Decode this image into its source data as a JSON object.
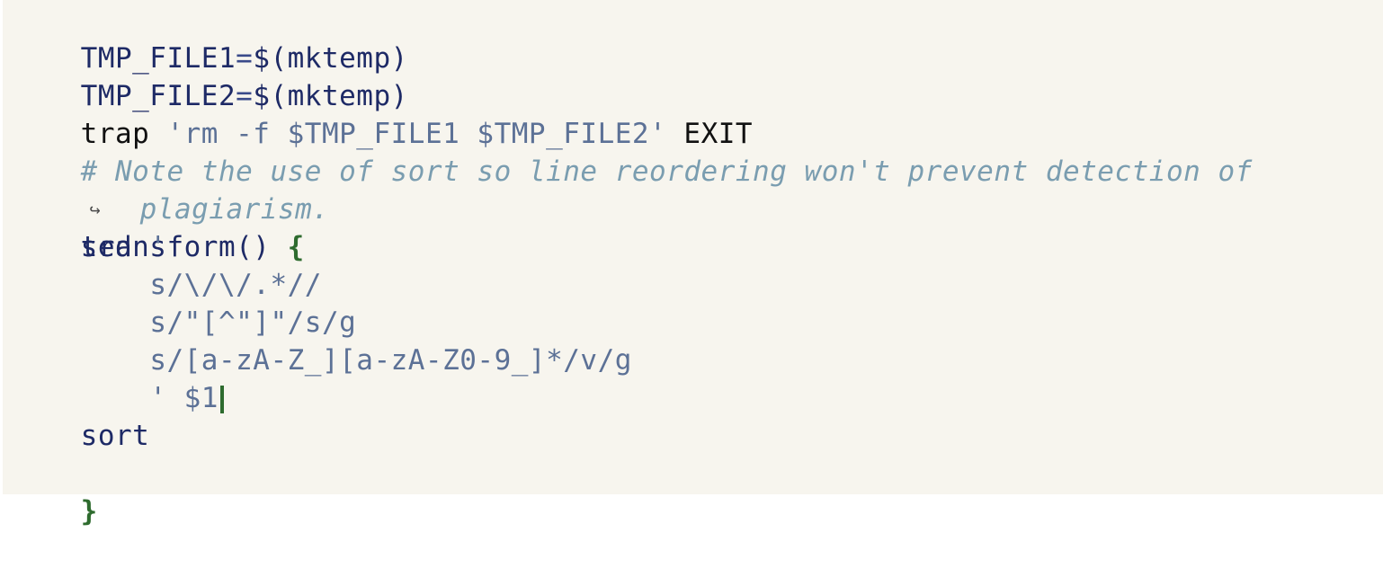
{
  "code": {
    "line1": {
      "var": "TMP_FILE1",
      "op": "=",
      "subst": "$(mktemp)"
    },
    "line2": {
      "var": "TMP_FILE2",
      "op": "=",
      "subst": "$(mktemp)"
    },
    "line3": {
      "cmd": "trap",
      "str": "'rm -f $TMP_FILE1 $TMP_FILE2'",
      "sig": "EXIT"
    },
    "comment": {
      "part1": "# Note the use of sort so line reordering won't prevent detection of",
      "part2": "plagiarism."
    },
    "func": {
      "name": "transform()",
      "open": "{",
      "close": "}"
    },
    "sed": {
      "cmd": "sed",
      "open_quote": "'",
      "rule1": "s/\\/\\/.*//",
      "rule2": "s/\"[^\"]\"/s/g",
      "rule3": "s/[a-zA-Z_][a-zA-Z0-9_]*/v/g",
      "close": "' $1"
    },
    "sort": "sort"
  },
  "icons": {
    "wrap": "↪"
  }
}
